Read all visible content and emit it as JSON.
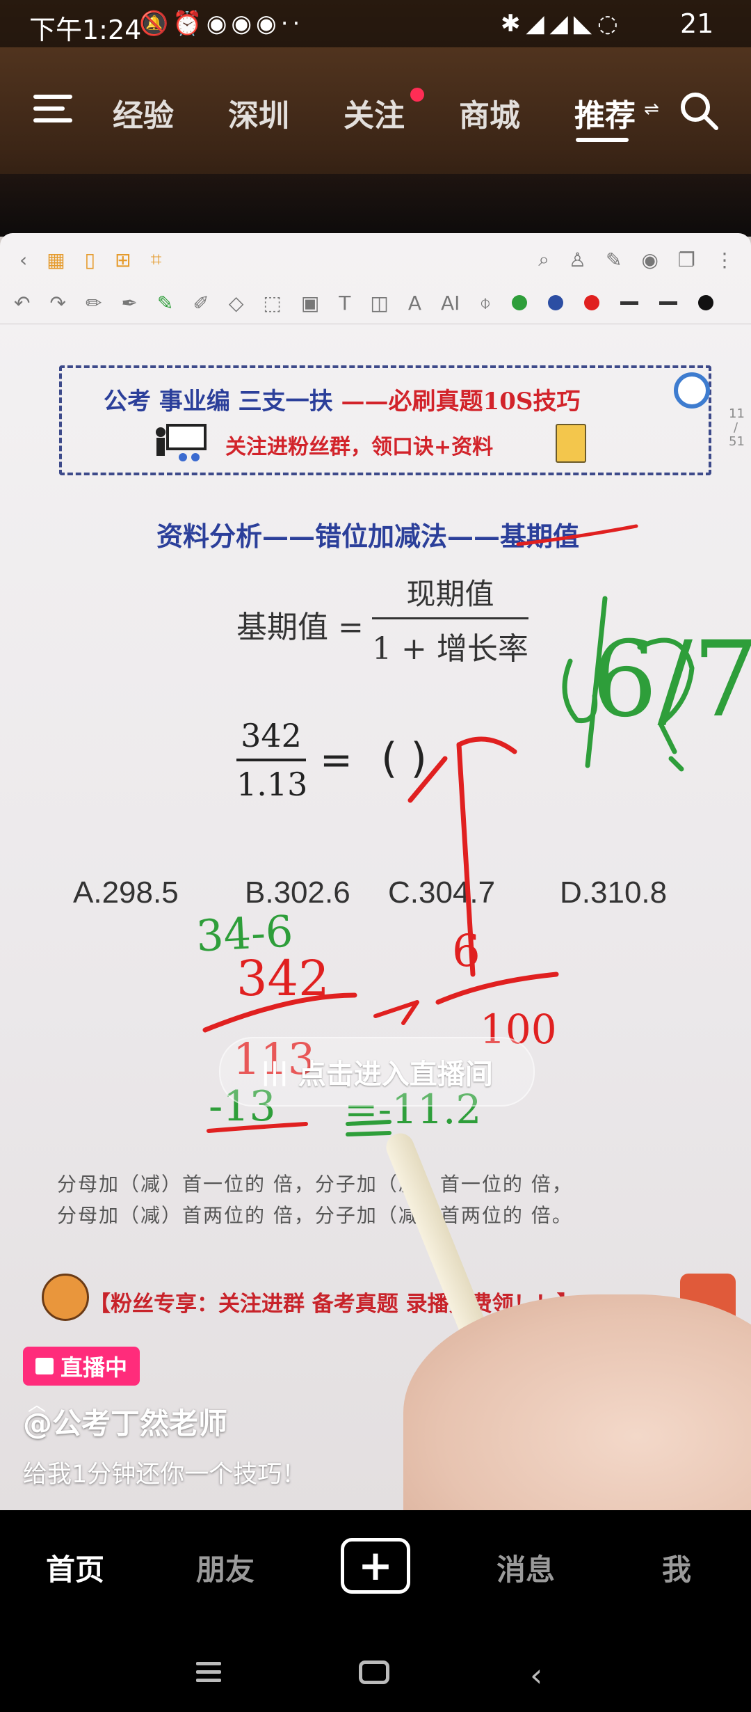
{
  "status_bar": {
    "time": "下午1:24",
    "battery": "21"
  },
  "top_nav": {
    "tabs": [
      "经验",
      "深圳",
      "关注",
      "商城",
      "推荐"
    ],
    "active_tab": "推荐"
  },
  "video_content": {
    "banner_title": "公考 事业编 三支一扶",
    "banner_title_red": "——必刷真题10S技巧",
    "banner_sub": "关注进粉丝群，领口诀+资料",
    "page_indicator": [
      "11",
      "/",
      "51"
    ],
    "subject_title": "资料分析——错位加减法——基期值",
    "formula_lhs": "基期值 =",
    "formula_num": "现期值",
    "formula_den": "1 + 增长率",
    "question_num": "342",
    "question_den": "1.13",
    "question_eq": "=",
    "question_paren": "(    )",
    "options": [
      "A.298.5",
      "B.302.6",
      "C.304.7",
      "D.310.8"
    ],
    "tip_line1": "分母加（减）首一位的  倍，分子加（减）首一位的  倍，",
    "tip_line2": "分母加（减）首两位的  倍，分子加（减）首两位的  倍。",
    "promo": "【粉丝专享：关注进群 备考真题 录播免费领！！】",
    "handwriting": {
      "green_top": "34-6",
      "red_frac_num": "342",
      "red_frac_den": "113",
      "green_small": "-13",
      "green_eq": "=-11.2",
      "green_result": "6/7",
      "red_frac2_num": "6",
      "red_frac2_den": "100"
    }
  },
  "live_overlay": {
    "text": "点击进入直播间"
  },
  "bottom_info": {
    "live_badge": "直播中",
    "author": "@公考丁然老师",
    "caption": "给我1分钟还你一个技巧！"
  },
  "tab_bar": {
    "items": [
      "首页",
      "朋友",
      "消息",
      "我"
    ],
    "active": "首页"
  },
  "colors": {
    "live_badge": "#ff2c7b",
    "notify_dot": "#ff2d55",
    "banner_blue": "#2b3f9a",
    "banner_red": "#d2232a",
    "ink_red": "#e02020",
    "ink_green": "#2e9e3a"
  }
}
